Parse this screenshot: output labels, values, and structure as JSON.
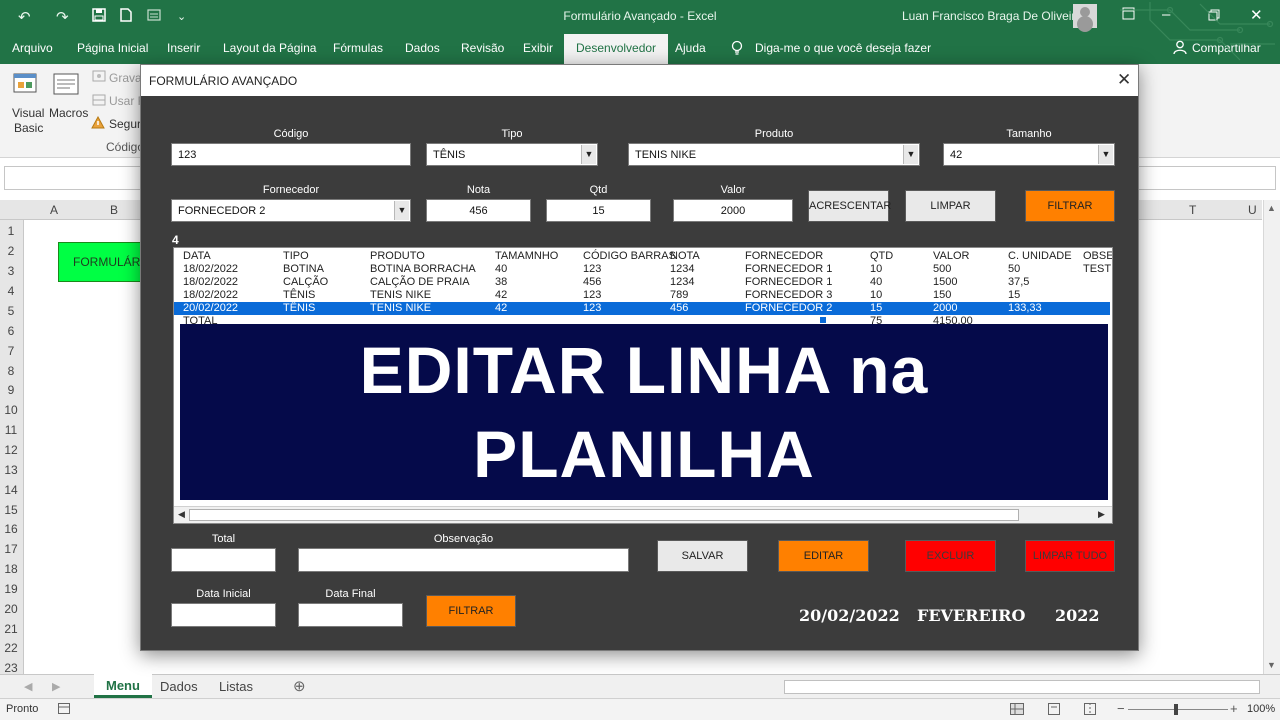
{
  "app": {
    "title": "Formulário Avançado  -  Excel",
    "user": "Luan Francisco Braga De Oliveira"
  },
  "ribbon_tabs": [
    "Arquivo",
    "Página Inicial",
    "Inserir",
    "Layout da Página",
    "Fórmulas",
    "Dados",
    "Revisão",
    "Exibir",
    "Desenvolvedor",
    "Ajuda"
  ],
  "active_tab": "Desenvolvedor",
  "tell_me": "Diga-me o que você deseja fazer",
  "share": "Compartilhar",
  "ribbon": {
    "visual_basic": "Visual Basic",
    "visual": "Visual",
    "basic": "Basic",
    "macros": "Macros",
    "gravar": "Gravar",
    "usar_r": "Usar R",
    "seguranca": "Segura",
    "group_codigo": "Código"
  },
  "grid": {
    "columns": [
      "A",
      "B",
      "T",
      "U"
    ],
    "rows": [
      "1",
      "2",
      "3",
      "4",
      "5",
      "6",
      "7",
      "8",
      "9",
      "10",
      "11",
      "12",
      "13",
      "14",
      "15",
      "16",
      "17",
      "18",
      "19",
      "20",
      "21",
      "22",
      "23"
    ],
    "green_cell": "FORMULÁRIO"
  },
  "sheets": [
    "Menu",
    "Dados",
    "Listas"
  ],
  "active_sheet": "Menu",
  "status": {
    "ready": "Pronto",
    "zoom": "100%"
  },
  "dialog": {
    "title": "FORMULÁRIO AVANÇADO",
    "labels": {
      "codigo": "Código",
      "tipo": "Tipo",
      "produto": "Produto",
      "tamanho": "Tamanho",
      "fornecedor": "Fornecedor",
      "nota": "Nota",
      "qtd": "Qtd",
      "valor": "Valor",
      "total": "Total",
      "observacao": "Observação",
      "data_inicial": "Data Inicial",
      "data_final": "Data Final"
    },
    "values": {
      "codigo": "123",
      "tipo": "TÊNIS",
      "produto": "TENIS NIKE",
      "tamanho": "42",
      "fornecedor": "FORNECEDOR 2",
      "nota": "456",
      "qtd": "15",
      "valor": "2000",
      "total": "",
      "observacao": "",
      "data_inicial": "",
      "data_final": ""
    },
    "buttons": {
      "acrescentar": "ACRESCENTAR",
      "limpar": "LIMPAR",
      "filtrar_top": "FILTRAR",
      "salvar": "SALVAR",
      "editar": "EDITAR",
      "excluir": "EXCLUIR",
      "limpar_tudo": "LIMPAR TUDO",
      "filtrar_bottom": "FILTRAR"
    },
    "row_index": "4",
    "list": {
      "headers": [
        "DATA",
        "TIPO",
        "PRODUTO",
        "TAMAMNHO",
        "CÓDIGO BARRAS",
        "NOTA",
        "FORNECEDOR",
        "QTD",
        "VALOR",
        "C. UNIDADE",
        "OBSER"
      ],
      "rows": [
        [
          "18/02/2022",
          "BOTINA",
          "BOTINA BORRACHA",
          "40",
          "123",
          "1234",
          "FORNECEDOR 1",
          "10",
          "500",
          "50",
          "TESTE"
        ],
        [
          "18/02/2022",
          "CALÇÃO",
          "CALÇÃO DE PRAIA",
          "38",
          "456",
          "1234",
          "FORNECEDOR 1",
          "40",
          "1500",
          "37,5",
          ""
        ],
        [
          "18/02/2022",
          "TÊNIS",
          "TENIS NIKE",
          "42",
          "123",
          "789",
          "FORNECEDOR 3",
          "10",
          "150",
          "15",
          ""
        ],
        [
          "20/02/2022",
          "TÊNIS",
          "TENIS NIKE",
          "42",
          "123",
          "456",
          "FORNECEDOR 2",
          "15",
          "2000",
          "133,33",
          ""
        ]
      ],
      "selected_row": 3,
      "total_row": {
        "label": "TOTAL",
        "qtd": "75",
        "valor": "4150,00"
      }
    },
    "banner": {
      "line1": "EDITAR LINHA na",
      "line2": "PLANILHA"
    },
    "footer": {
      "date": "20/02/2022",
      "month": "FEVEREIRO",
      "year": "2022"
    }
  }
}
